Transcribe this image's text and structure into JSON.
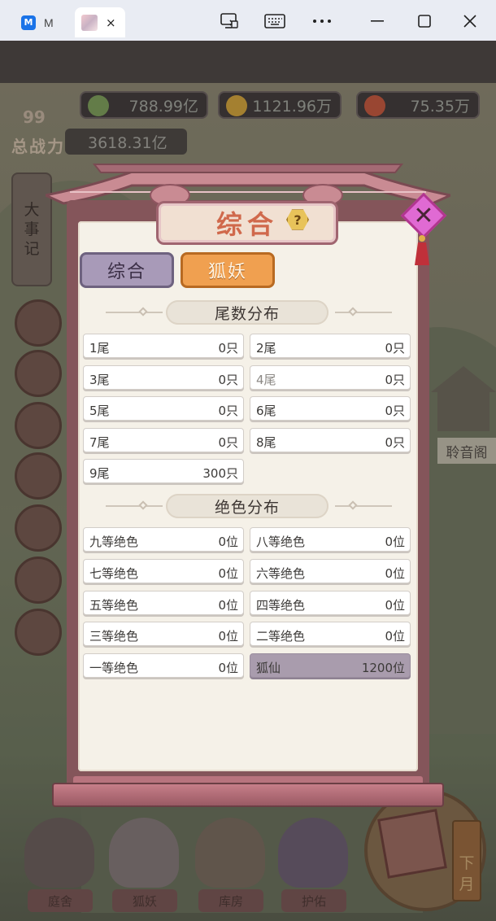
{
  "browser": {
    "tab1_label": "M",
    "tab_close": "×"
  },
  "resources": [
    "788.99亿",
    "1121.96万",
    "75.35万"
  ],
  "power": {
    "level": "99",
    "label": "总战力",
    "value": "3618.31亿"
  },
  "side_menu": [
    "大",
    "事",
    "记"
  ],
  "pavilion_label": "聆音阁",
  "bottom_nav": [
    "庭舍",
    "狐妖",
    "库房",
    "护佑"
  ],
  "next_month": [
    "下",
    "月"
  ],
  "dialog": {
    "title": "综合",
    "help_icon": "?",
    "close_icon": "✕",
    "tabs": [
      "综合",
      "狐妖"
    ],
    "active_tab": "狐妖",
    "sections": [
      {
        "title": "尾数分布",
        "items": [
          {
            "label": "1尾",
            "value": "0只"
          },
          {
            "label": "2尾",
            "value": "0只"
          },
          {
            "label": "3尾",
            "value": "0只"
          },
          {
            "label": "4尾",
            "value": "0只"
          },
          {
            "label": "5尾",
            "value": "0只"
          },
          {
            "label": "6尾",
            "value": "0只"
          },
          {
            "label": "7尾",
            "value": "0只"
          },
          {
            "label": "8尾",
            "value": "0只"
          },
          {
            "label": "9尾",
            "value": "300只"
          }
        ]
      },
      {
        "title": "绝色分布",
        "items": [
          {
            "label": "九等绝色",
            "value": "0位"
          },
          {
            "label": "八等绝色",
            "value": "0位"
          },
          {
            "label": "七等绝色",
            "value": "0位"
          },
          {
            "label": "六等绝色",
            "value": "0位"
          },
          {
            "label": "五等绝色",
            "value": "0位"
          },
          {
            "label": "四等绝色",
            "value": "0位"
          },
          {
            "label": "三等绝色",
            "value": "0位"
          },
          {
            "label": "二等绝色",
            "value": "0位"
          },
          {
            "label": "一等绝色",
            "value": "0位"
          },
          {
            "label": "狐仙",
            "value": "1200位"
          }
        ]
      }
    ]
  },
  "colors": {
    "accent_orange": "#f0a050",
    "title_red": "#d0694c",
    "frame_pink": "#84555a",
    "paper": "#f5f1e8"
  }
}
